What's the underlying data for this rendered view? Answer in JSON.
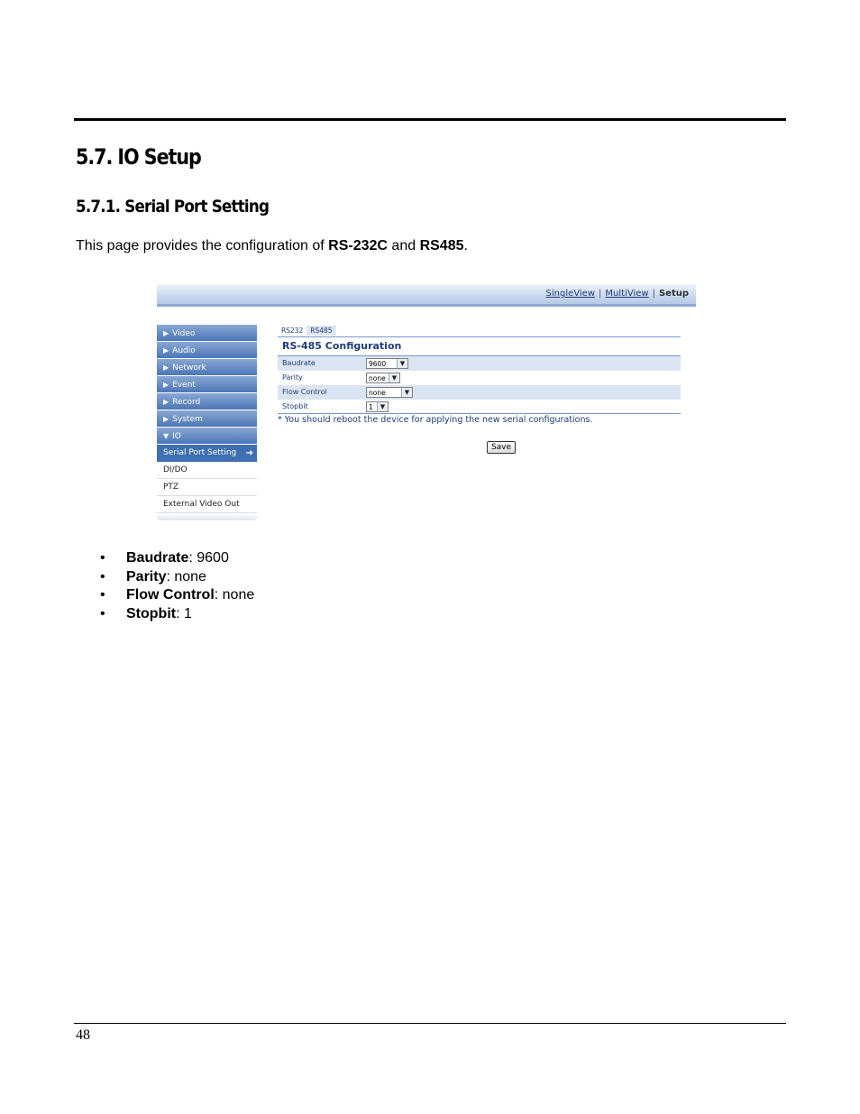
{
  "heading1": "5.7.  IO Setup",
  "heading2": "5.7.1. Serial Port Setting",
  "intro": {
    "before": "This page provides the configuration of ",
    "term1": "RS-232C",
    "middle": " and ",
    "term2": "RS485",
    "after": "."
  },
  "screenshot": {
    "topnav": {
      "single": "SingleView",
      "multi": "MultiView",
      "setup": "Setup",
      "separator": "|"
    },
    "menu": [
      {
        "tri": "▶",
        "label": "Video"
      },
      {
        "tri": "▶",
        "label": "Audio"
      },
      {
        "tri": "▶",
        "label": "Network"
      },
      {
        "tri": "▶",
        "label": "Event"
      },
      {
        "tri": "▶",
        "label": "Record"
      },
      {
        "tri": "▶",
        "label": "System"
      },
      {
        "tri": "▼",
        "label": "IO"
      }
    ],
    "active_item": "Serial Port Setting",
    "sub_items": [
      "DI/DO",
      "PTZ",
      "External Video Out"
    ],
    "tabs": [
      "RS232",
      "RS485"
    ],
    "form_title": "RS-485 Configuration",
    "fields": [
      {
        "label": "Baudrate",
        "value": "9600"
      },
      {
        "label": "Parity",
        "value": "none"
      },
      {
        "label": "Flow Control",
        "value": "none"
      },
      {
        "label": "Stopbit",
        "value": "1"
      }
    ],
    "note": "* You should reboot the device for applying the new serial configurations.",
    "save_label": "Save"
  },
  "bullets": [
    {
      "term": "Baudrate",
      "value": ": 9600"
    },
    {
      "term": "Parity",
      "value": ": none"
    },
    {
      "term": "Flow Control",
      "value": ": none"
    },
    {
      "term": "Stopbit",
      "value": ": 1"
    }
  ],
  "page_number": "48"
}
